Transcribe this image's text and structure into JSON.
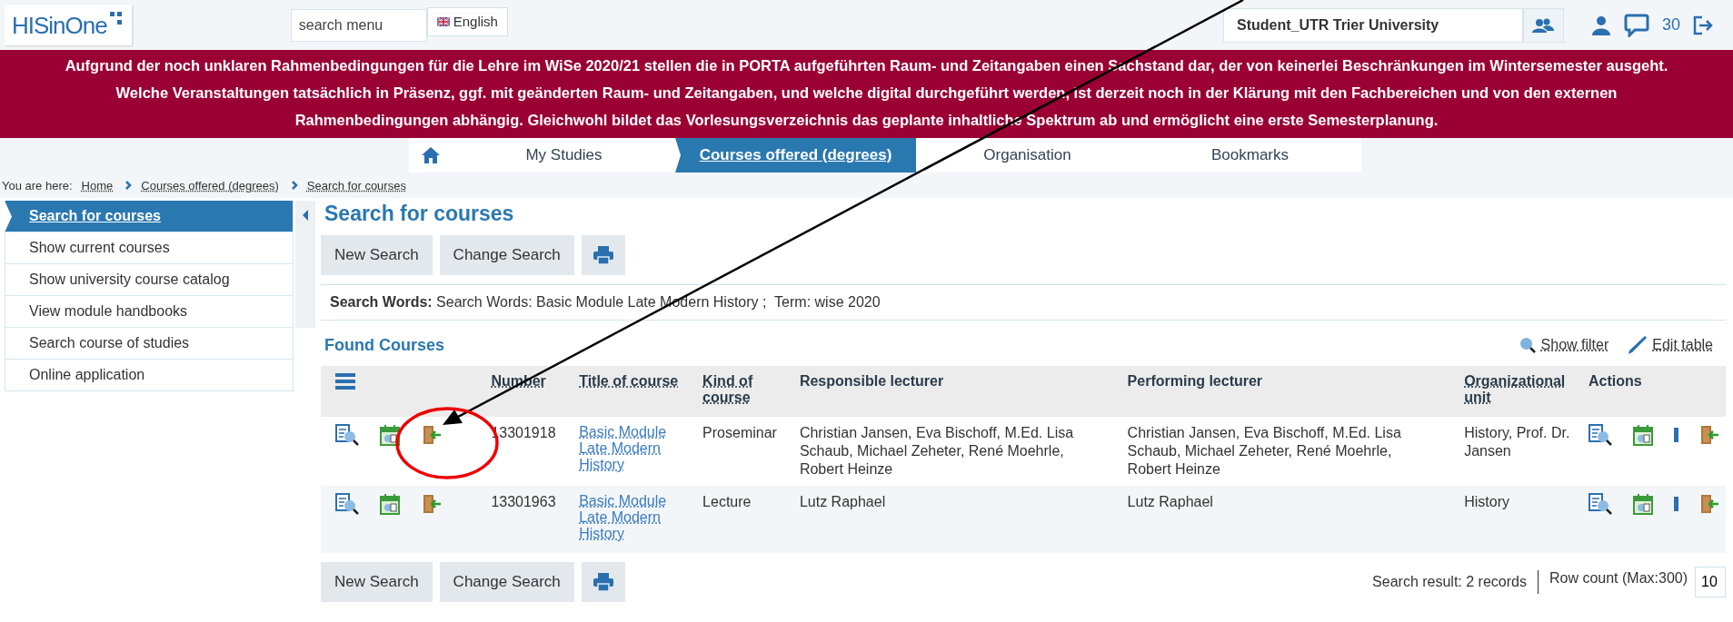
{
  "header": {
    "logo": "HISinOne",
    "search": {
      "placeholder": "search menu"
    },
    "language": "English",
    "role": "Student_UTR Trier University",
    "message_count": "30"
  },
  "banner": "Aufgrund der noch unklaren Rahmenbedingungen für die Lehre im WiSe 2020/21 stellen die in PORTA aufgeführten Raum- und Zeitangaben einen Sachstand dar, der von keinerlei Beschränkungen im Wintersemester ausgeht. Welche Veranstaltungen tatsächlich in Präsenz, ggf. mit geänderten Raum- und Zeitangaben, und welche digital durchgeführt werden, ist derzeit noch in der Klärung mit den Fachbereichen und von den externen Rahmenbedingungen abhängig. Gleichwohl bildet das Vorlesungsverzeichnis das geplante inhaltliche Spektrum ab und ermöglicht eine erste Semesterplanung.",
  "nav_tabs": [
    {
      "label": "My Studies",
      "selected": false
    },
    {
      "label": "Courses offered (degrees)",
      "selected": true
    },
    {
      "label": "Organisation",
      "selected": false
    },
    {
      "label": "Bookmarks",
      "selected": false
    }
  ],
  "breadcrumb": {
    "label": "You are here:",
    "items": [
      "Home",
      "Courses offered (degrees)",
      "Search for courses"
    ]
  },
  "sidebar": {
    "items": [
      {
        "label": "Search for courses",
        "selected": true
      },
      {
        "label": "Show current courses",
        "selected": false
      },
      {
        "label": "Show university course catalog",
        "selected": false
      },
      {
        "label": "View module handbooks",
        "selected": false
      },
      {
        "label": "Search course of studies",
        "selected": false
      },
      {
        "label": "Online application",
        "selected": false
      }
    ]
  },
  "page_title": "Search for courses",
  "buttons": [
    "New Search",
    "Change Search"
  ],
  "search_summary": "**Search Words:** Search Words: Basic Module Late Modern History ;  Term: wise 2020",
  "results": {
    "title": "Found Courses",
    "show_filter": "Show filter",
    "edit_table": "Edit table",
    "columns": [
      {
        "label": "Number",
        "sortable": true
      },
      {
        "label": "Title of course",
        "sortable": true
      },
      {
        "label": "Kind of course",
        "sortable": true
      },
      {
        "label": "Responsible lecturer",
        "sortable": false
      },
      {
        "label": "Performing lecturer",
        "sortable": false
      },
      {
        "label": "Organizational unit",
        "sortable": true
      },
      {
        "label": "Actions",
        "sortable": false
      }
    ],
    "rows": [
      {
        "number": "13301918",
        "title": "Basic Module Late Modern History",
        "kind": "Proseminar",
        "responsible": "Christian Jansen, Eva Bischoff, M.Ed. Lisa Schaub, Michael Zeheter, René Moehrle, Robert Heinze",
        "performing": "Christian Jansen, Eva Bischoff, M.Ed. Lisa Schaub, Michael Zeheter, René Moehrle, Robert Heinze",
        "unit": "History, Prof. Dr. Jansen"
      },
      {
        "number": "13301963",
        "title": "Basic Module Late Modern History",
        "kind": "Lecture",
        "responsible": "Lutz Raphael",
        "performing": "Lutz Raphael",
        "unit": "History"
      }
    ],
    "bottom_buttons": [
      "New Search",
      "Change Search"
    ],
    "result_count": "Search result: 2 records",
    "row_count_label": "Row count (Max:300)",
    "row_count": "10"
  }
}
